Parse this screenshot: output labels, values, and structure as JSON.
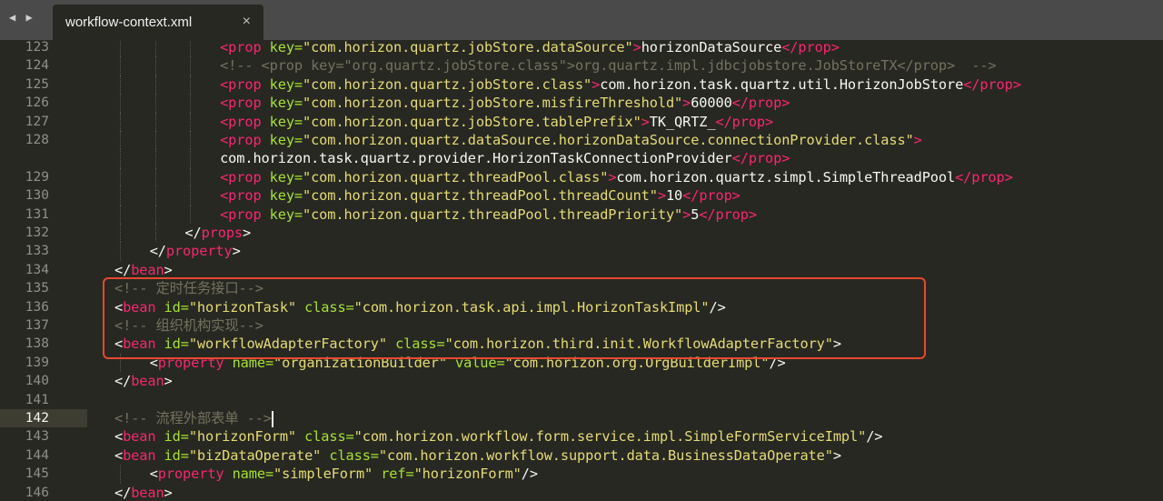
{
  "tabbar": {
    "nav_arrows": "◀ ▶",
    "tab_title": "workflow-context.xml",
    "tab_close": "×"
  },
  "lines": [
    {
      "n": "123",
      "indent": 6,
      "parts": [
        [
          "t",
          "<prop "
        ],
        [
          "a",
          "key="
        ],
        [
          "s",
          "\"com.horizon.quartz.jobStore.dataSource\""
        ],
        [
          "t",
          ">"
        ],
        [
          "p",
          "horizonDataSource"
        ],
        [
          "t",
          "</prop>"
        ]
      ]
    },
    {
      "n": "124",
      "indent": 6,
      "parts": [
        [
          "c",
          "<!-- <prop key=\"org.quartz.jobStore.class\">org.quartz.impl.jdbcjobstore.JobStoreTX</prop>  -->"
        ]
      ]
    },
    {
      "n": "125",
      "indent": 6,
      "parts": [
        [
          "t",
          "<prop "
        ],
        [
          "a",
          "key="
        ],
        [
          "s",
          "\"com.horizon.quartz.jobStore.class\""
        ],
        [
          "t",
          ">"
        ],
        [
          "p",
          "com.horizon.task.quartz.util.HorizonJobStore"
        ],
        [
          "t",
          "</prop>"
        ]
      ]
    },
    {
      "n": "126",
      "indent": 6,
      "parts": [
        [
          "t",
          "<prop "
        ],
        [
          "a",
          "key="
        ],
        [
          "s",
          "\"com.horizon.quartz.jobStore.misfireThreshold\""
        ],
        [
          "t",
          ">"
        ],
        [
          "p",
          "60000"
        ],
        [
          "t",
          "</prop>"
        ]
      ]
    },
    {
      "n": "127",
      "indent": 6,
      "parts": [
        [
          "t",
          "<prop "
        ],
        [
          "a",
          "key="
        ],
        [
          "s",
          "\"com.horizon.quartz.jobStore.tablePrefix\""
        ],
        [
          "t",
          ">"
        ],
        [
          "p",
          "TK_QRTZ_"
        ],
        [
          "t",
          "</prop>"
        ]
      ]
    },
    {
      "n": "128",
      "indent": 6,
      "parts": [
        [
          "t",
          "<prop "
        ],
        [
          "a",
          "key="
        ],
        [
          "s",
          "\"com.horizon.quartz.dataSource.horizonDataSource.connectionProvider.class\""
        ],
        [
          "t",
          ">"
        ]
      ]
    },
    {
      "n": "",
      "indent": 6,
      "parts": [
        [
          "p",
          "com.horizon.task.quartz.provider.HorizonTaskConnectionProvider"
        ],
        [
          "t",
          "</prop>"
        ]
      ]
    },
    {
      "n": "129",
      "indent": 6,
      "parts": [
        [
          "t",
          "<prop "
        ],
        [
          "a",
          "key="
        ],
        [
          "s",
          "\"com.horizon.quartz.threadPool.class\""
        ],
        [
          "t",
          ">"
        ],
        [
          "p",
          "com.horizon.quartz.simpl.SimpleThreadPool"
        ],
        [
          "t",
          "</prop>"
        ]
      ]
    },
    {
      "n": "130",
      "indent": 6,
      "parts": [
        [
          "t",
          "<prop "
        ],
        [
          "a",
          "key="
        ],
        [
          "s",
          "\"com.horizon.quartz.threadPool.threadCount\""
        ],
        [
          "t",
          ">"
        ],
        [
          "p",
          "10"
        ],
        [
          "t",
          "</prop>"
        ]
      ]
    },
    {
      "n": "131",
      "indent": 6,
      "parts": [
        [
          "t",
          "<prop "
        ],
        [
          "a",
          "key="
        ],
        [
          "s",
          "\"com.horizon.quartz.threadPool.threadPriority\""
        ],
        [
          "t",
          ">"
        ],
        [
          "p",
          "5"
        ],
        [
          "t",
          "</prop>"
        ]
      ]
    },
    {
      "n": "132",
      "indent": 5,
      "parts": [
        [
          "p",
          "</"
        ],
        [
          "t",
          "props"
        ],
        [
          "p",
          ">"
        ]
      ]
    },
    {
      "n": "133",
      "indent": 4,
      "parts": [
        [
          "p",
          "</"
        ],
        [
          "t",
          "property"
        ],
        [
          "p",
          ">"
        ]
      ]
    },
    {
      "n": "134",
      "indent": 3,
      "parts": [
        [
          "p",
          "</"
        ],
        [
          "t",
          "bean"
        ],
        [
          "p",
          ">"
        ]
      ]
    },
    {
      "n": "135",
      "indent": 3,
      "parts": [
        [
          "c",
          "<!-- 定时任务接口-->"
        ]
      ]
    },
    {
      "n": "136",
      "indent": 3,
      "parts": [
        [
          "p",
          "<"
        ],
        [
          "t",
          "bean "
        ],
        [
          "a",
          "id="
        ],
        [
          "s",
          "\"horizonTask\" "
        ],
        [
          "a",
          "class="
        ],
        [
          "s",
          "\"com.horizon.task.api.impl.HorizonTaskImpl\""
        ],
        [
          "p",
          "/>"
        ]
      ]
    },
    {
      "n": "137",
      "indent": 3,
      "parts": [
        [
          "c",
          "<!-- 组织机构实现-->"
        ]
      ]
    },
    {
      "n": "138",
      "indent": 3,
      "parts": [
        [
          "p",
          "<"
        ],
        [
          "t",
          "bean "
        ],
        [
          "a",
          "id="
        ],
        [
          "s",
          "\"workflowAdapterFactory\" "
        ],
        [
          "a",
          "class="
        ],
        [
          "s",
          "\"com.horizon.third.init.WorkflowAdapterFactory\""
        ],
        [
          "p",
          ">"
        ]
      ]
    },
    {
      "n": "139",
      "indent": 4,
      "parts": [
        [
          "p",
          "<"
        ],
        [
          "t",
          "property "
        ],
        [
          "a",
          "name="
        ],
        [
          "s",
          "\"organizationBuilder\" "
        ],
        [
          "a",
          "value="
        ],
        [
          "s",
          "\"com.horizon.org.OrgBuilderImpl\""
        ],
        [
          "p",
          "/>"
        ]
      ]
    },
    {
      "n": "140",
      "indent": 3,
      "parts": [
        [
          "p",
          "</"
        ],
        [
          "t",
          "bean"
        ],
        [
          "p",
          ">"
        ]
      ]
    },
    {
      "n": "141",
      "indent": 3,
      "parts": []
    },
    {
      "n": "142",
      "indent": 3,
      "active": true,
      "parts": [
        [
          "c",
          "<!-- 流程外部表单 -->"
        ]
      ]
    },
    {
      "n": "143",
      "indent": 3,
      "parts": [
        [
          "p",
          "<"
        ],
        [
          "t",
          "bean "
        ],
        [
          "a",
          "id="
        ],
        [
          "s",
          "\"horizonForm\" "
        ],
        [
          "a",
          "class="
        ],
        [
          "s",
          "\"com.horizon.workflow.form.service.impl.SimpleFormServiceImpl\""
        ],
        [
          "p",
          "/>"
        ]
      ]
    },
    {
      "n": "144",
      "indent": 3,
      "parts": [
        [
          "p",
          "<"
        ],
        [
          "t",
          "bean "
        ],
        [
          "a",
          "id="
        ],
        [
          "s",
          "\"bizDataOperate\" "
        ],
        [
          "a",
          "class="
        ],
        [
          "s",
          "\"com.horizon.workflow.support.data.BusinessDataOperate\""
        ],
        [
          "p",
          ">"
        ]
      ]
    },
    {
      "n": "145",
      "indent": 4,
      "parts": [
        [
          "p",
          "<"
        ],
        [
          "t",
          "property "
        ],
        [
          "a",
          "name="
        ],
        [
          "s",
          "\"simpleForm\" "
        ],
        [
          "a",
          "ref="
        ],
        [
          "s",
          "\"horizonForm\""
        ],
        [
          "p",
          "/>"
        ]
      ]
    },
    {
      "n": "146",
      "indent": 3,
      "parts": [
        [
          "p",
          "</"
        ],
        [
          "t",
          "bean"
        ],
        [
          "p",
          ">"
        ]
      ]
    }
  ]
}
